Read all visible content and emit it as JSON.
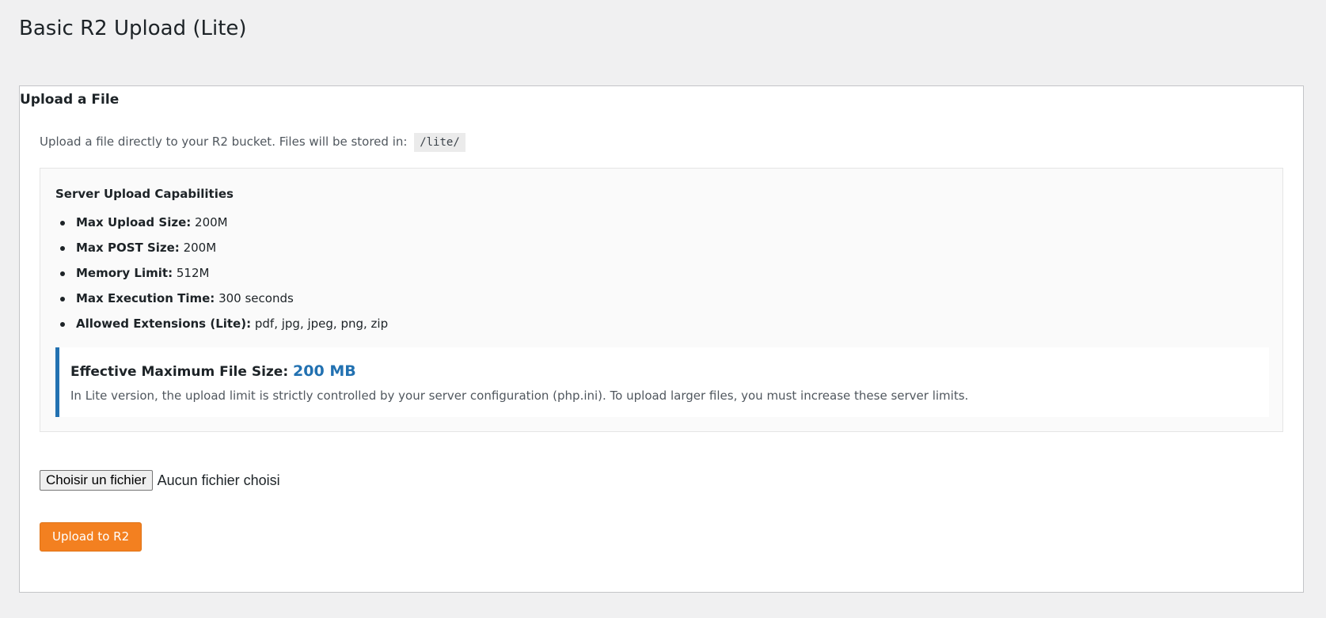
{
  "page": {
    "title": "Basic R2 Upload (Lite)"
  },
  "card": {
    "title": "Upload a File",
    "intro": "Upload a file directly to your R2 bucket. Files will be stored in:",
    "path": "/lite/"
  },
  "capabilities": {
    "title": "Server Upload Capabilities",
    "items": [
      {
        "label": "Max Upload Size:",
        "value": "200M"
      },
      {
        "label": "Max POST Size:",
        "value": "200M"
      },
      {
        "label": "Memory Limit:",
        "value": "512M"
      },
      {
        "label": "Max Execution Time:",
        "value": "300 seconds"
      },
      {
        "label": "Allowed Extensions (Lite):",
        "value": "pdf, jpg, jpeg, png, zip"
      }
    ],
    "effective": {
      "label": "Effective Maximum File Size:",
      "value": "200 MB",
      "note": "In Lite version, the upload limit is strictly controlled by your server configuration (php.ini). To upload larger files, you must increase these server limits."
    }
  },
  "file_input": {
    "button_label": "Choisir un fichier",
    "status": "Aucun fichier choisi"
  },
  "upload": {
    "label": "Upload to R2"
  },
  "colors": {
    "background": "#f0f0f1",
    "accent_blue": "#2271b1",
    "upload_button": "#f38020"
  }
}
